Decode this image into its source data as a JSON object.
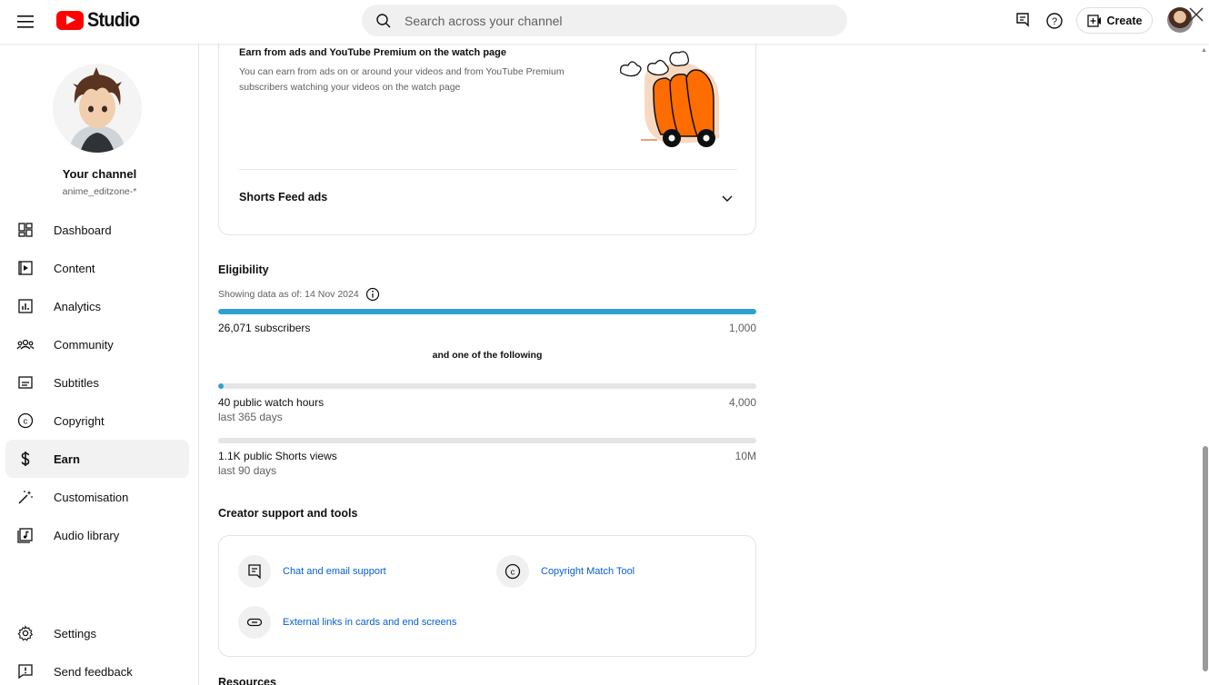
{
  "app": {
    "logo_text": "Studio",
    "search_placeholder": "Search across your channel",
    "create_label": "Create"
  },
  "channel": {
    "title": "Your channel",
    "handle": "anime_editzone-*"
  },
  "nav": {
    "items": [
      {
        "label": "Dashboard",
        "icon": "dashboard-icon"
      },
      {
        "label": "Content",
        "icon": "content-icon"
      },
      {
        "label": "Analytics",
        "icon": "analytics-icon"
      },
      {
        "label": "Community",
        "icon": "community-icon"
      },
      {
        "label": "Subtitles",
        "icon": "subtitles-icon"
      },
      {
        "label": "Copyright",
        "icon": "copyright-icon"
      },
      {
        "label": "Earn",
        "icon": "earn-icon",
        "active": true
      },
      {
        "label": "Customisation",
        "icon": "customisation-icon"
      },
      {
        "label": "Audio library",
        "icon": "audio-library-icon"
      }
    ],
    "settings_label": "Settings",
    "feedback_label": "Send feedback"
  },
  "earn": {
    "watch_page_title": "Earn from ads and YouTube Premium on the watch page",
    "watch_page_desc": "You can earn from ads on or around your videos and from YouTube Premium subscribers watching your videos on the watch page",
    "shorts_feed_label": "Shorts Feed ads"
  },
  "eligibility": {
    "title": "Eligibility",
    "showing_text": "Showing data as of: 14 Nov 2024",
    "subscribers": {
      "label": "26,071 subscribers",
      "target": "1,000",
      "progress": 1.0
    },
    "or_text": "and one of the following",
    "watch_hours": {
      "label": "40 public watch hours",
      "sub": "last 365 days",
      "target": "4,000",
      "progress": 0.01
    },
    "shorts_views": {
      "label": "1.1K public Shorts views",
      "sub": "last 90 days",
      "target": "10M",
      "progress": 0.0
    }
  },
  "creator_tools": {
    "title": "Creator support and tools",
    "items": [
      {
        "label": "Chat and email support",
        "icon": "chat-icon"
      },
      {
        "label": "Copyright Match Tool",
        "icon": "copyright-icon"
      },
      {
        "label": "External links in cards and end screens",
        "icon": "link-icon"
      }
    ]
  },
  "resources_title": "Resources",
  "colors": {
    "accent": "#2fa0cf",
    "link": "#065fd4",
    "brand_red": "#ff0000"
  }
}
